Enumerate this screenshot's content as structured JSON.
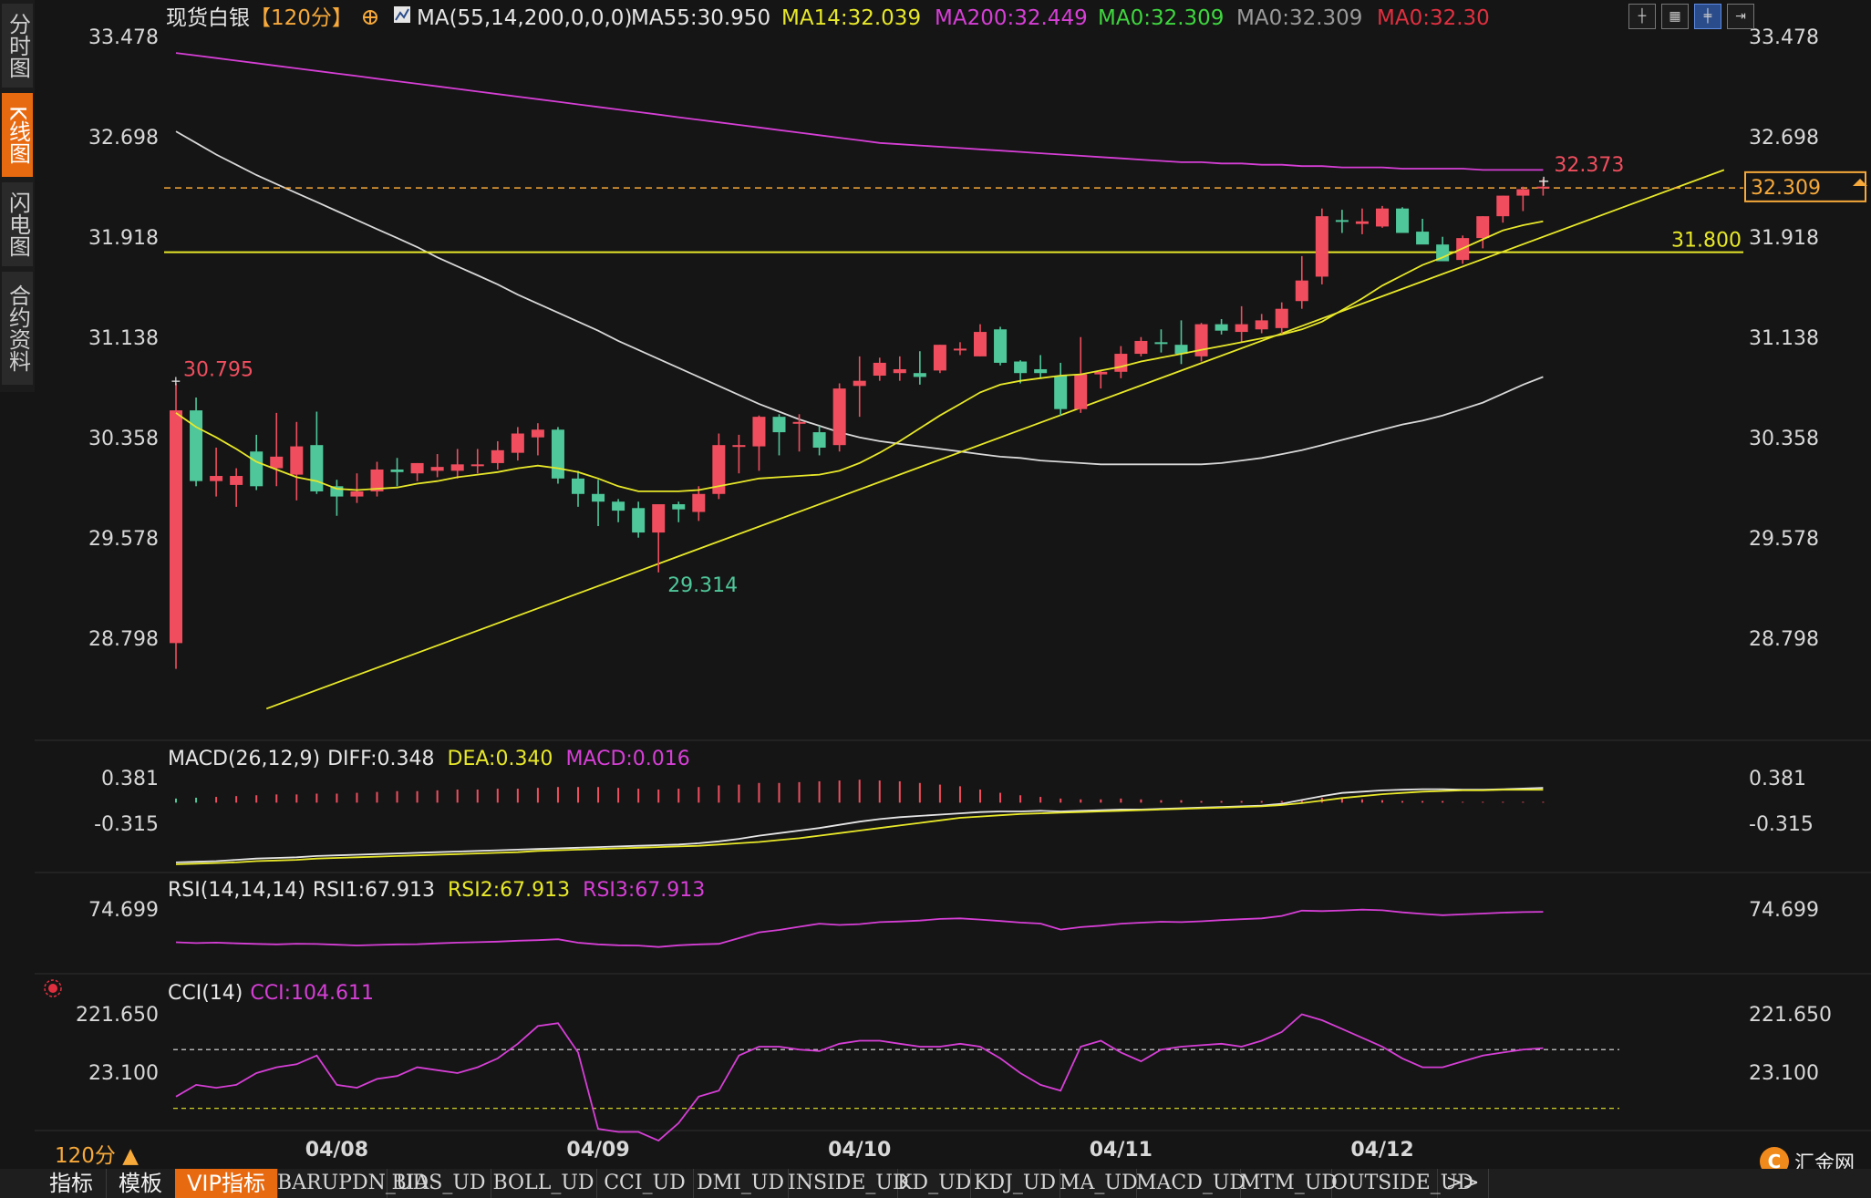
{
  "sidebar": {
    "tabs": [
      {
        "label": "分时图",
        "active": false
      },
      {
        "label": "K线图",
        "active": true
      },
      {
        "label": "闪电图",
        "active": false
      },
      {
        "label": "合约资料",
        "active": false
      }
    ]
  },
  "header": {
    "title": "现货白银",
    "period_tag": "【120分】",
    "indicator": "MA(55,14,200,0,0,0)",
    "ma55": "MA55:30.950",
    "ma14": "MA14:32.039",
    "ma200": "MA200:32.449",
    "ma0a": "MA0:32.309",
    "ma0b": "MA0:32.309",
    "ma0c": "MA0:32.30"
  },
  "colors": {
    "up": "#f04e5e",
    "down": "#4fc79a",
    "ma14": "#e8e82a",
    "ma55": "#d8d8d8",
    "ma200": "#d63fd6",
    "accent": "#f7a93a",
    "bg": "#151515",
    "grid": "#333333"
  },
  "toolbar": {
    "icons": [
      "crosshair-icon",
      "grid-icon",
      "candle-icon",
      "expand-icon"
    ]
  },
  "chart_data": [
    {
      "type": "candlestick",
      "panel": "price",
      "ylim": [
        28.2,
        33.5
      ],
      "yticks": [
        "33.478",
        "32.698",
        "31.918",
        "31.138",
        "30.358",
        "29.578",
        "28.798"
      ],
      "x_date_labels": [
        {
          "label": "04/08",
          "index": 8
        },
        {
          "label": "04/09",
          "index": 21
        },
        {
          "label": "04/10",
          "index": 34
        },
        {
          "label": "04/11",
          "index": 47
        },
        {
          "label": "04/12",
          "index": 60
        }
      ],
      "candles": [
        {
          "o": 28.76,
          "h": 30.78,
          "l": 28.56,
          "c": 30.57
        },
        {
          "o": 30.57,
          "h": 30.67,
          "l": 29.98,
          "c": 30.02
        },
        {
          "o": 30.02,
          "h": 30.28,
          "l": 29.9,
          "c": 30.06
        },
        {
          "o": 29.99,
          "h": 30.12,
          "l": 29.82,
          "c": 30.06
        },
        {
          "o": 30.25,
          "h": 30.38,
          "l": 29.95,
          "c": 29.98
        },
        {
          "o": 30.12,
          "h": 30.55,
          "l": 29.98,
          "c": 30.21
        },
        {
          "o": 30.07,
          "h": 30.48,
          "l": 29.87,
          "c": 30.29
        },
        {
          "o": 30.3,
          "h": 30.56,
          "l": 29.92,
          "c": 29.94
        },
        {
          "o": 29.98,
          "h": 30.03,
          "l": 29.75,
          "c": 29.9
        },
        {
          "o": 29.9,
          "h": 30.08,
          "l": 29.85,
          "c": 29.94
        },
        {
          "o": 29.94,
          "h": 30.17,
          "l": 29.9,
          "c": 30.11
        },
        {
          "o": 30.11,
          "h": 30.2,
          "l": 29.98,
          "c": 30.09
        },
        {
          "o": 30.08,
          "h": 30.16,
          "l": 30.02,
          "c": 30.16
        },
        {
          "o": 30.1,
          "h": 30.23,
          "l": 30.05,
          "c": 30.13
        },
        {
          "o": 30.1,
          "h": 30.27,
          "l": 30.04,
          "c": 30.15
        },
        {
          "o": 30.15,
          "h": 30.27,
          "l": 30.08,
          "c": 30.15
        },
        {
          "o": 30.16,
          "h": 30.33,
          "l": 30.11,
          "c": 30.26
        },
        {
          "o": 30.24,
          "h": 30.44,
          "l": 30.18,
          "c": 30.39
        },
        {
          "o": 30.36,
          "h": 30.47,
          "l": 30.22,
          "c": 30.42
        },
        {
          "o": 30.42,
          "h": 30.44,
          "l": 30.0,
          "c": 30.04
        },
        {
          "o": 30.04,
          "h": 30.1,
          "l": 29.82,
          "c": 29.92
        },
        {
          "o": 29.92,
          "h": 30.03,
          "l": 29.67,
          "c": 29.86
        },
        {
          "o": 29.86,
          "h": 29.88,
          "l": 29.7,
          "c": 29.79
        },
        {
          "o": 29.81,
          "h": 29.86,
          "l": 29.58,
          "c": 29.62
        },
        {
          "o": 29.62,
          "h": 29.82,
          "l": 29.31,
          "c": 29.84
        },
        {
          "o": 29.84,
          "h": 29.86,
          "l": 29.7,
          "c": 29.8
        },
        {
          "o": 29.78,
          "h": 29.98,
          "l": 29.71,
          "c": 29.92
        },
        {
          "o": 29.92,
          "h": 30.39,
          "l": 29.88,
          "c": 30.3
        },
        {
          "o": 30.3,
          "h": 30.38,
          "l": 30.08,
          "c": 30.3
        },
        {
          "o": 30.29,
          "h": 30.53,
          "l": 30.1,
          "c": 30.52
        },
        {
          "o": 30.52,
          "h": 30.54,
          "l": 30.22,
          "c": 30.4
        },
        {
          "o": 30.48,
          "h": 30.54,
          "l": 30.25,
          "c": 30.48
        },
        {
          "o": 30.4,
          "h": 30.45,
          "l": 30.22,
          "c": 30.28
        },
        {
          "o": 30.3,
          "h": 30.78,
          "l": 30.25,
          "c": 30.74
        },
        {
          "o": 30.76,
          "h": 30.99,
          "l": 30.52,
          "c": 30.8
        },
        {
          "o": 30.84,
          "h": 30.98,
          "l": 30.8,
          "c": 30.94
        },
        {
          "o": 30.86,
          "h": 30.99,
          "l": 30.8,
          "c": 30.89
        },
        {
          "o": 30.86,
          "h": 31.03,
          "l": 30.77,
          "c": 30.83
        },
        {
          "o": 30.88,
          "h": 31.08,
          "l": 30.86,
          "c": 31.08
        },
        {
          "o": 31.05,
          "h": 31.1,
          "l": 31.0,
          "c": 31.05
        },
        {
          "o": 30.99,
          "h": 31.24,
          "l": 30.99,
          "c": 31.18
        },
        {
          "o": 31.2,
          "h": 31.22,
          "l": 30.92,
          "c": 30.94
        },
        {
          "o": 30.95,
          "h": 30.96,
          "l": 30.78,
          "c": 30.86
        },
        {
          "o": 30.89,
          "h": 31.0,
          "l": 30.82,
          "c": 30.86
        },
        {
          "o": 30.84,
          "h": 30.94,
          "l": 30.53,
          "c": 30.58
        },
        {
          "o": 30.58,
          "h": 31.14,
          "l": 30.55,
          "c": 30.85
        },
        {
          "o": 30.85,
          "h": 30.88,
          "l": 30.74,
          "c": 30.87
        },
        {
          "o": 30.87,
          "h": 31.07,
          "l": 30.82,
          "c": 31.01
        },
        {
          "o": 31.01,
          "h": 31.14,
          "l": 30.99,
          "c": 31.11
        },
        {
          "o": 31.1,
          "h": 31.2,
          "l": 31.02,
          "c": 31.09
        },
        {
          "o": 31.08,
          "h": 31.27,
          "l": 30.93,
          "c": 31.01
        },
        {
          "o": 30.99,
          "h": 31.25,
          "l": 30.95,
          "c": 31.24
        },
        {
          "o": 31.24,
          "h": 31.28,
          "l": 31.16,
          "c": 31.19
        },
        {
          "o": 31.18,
          "h": 31.38,
          "l": 31.1,
          "c": 31.24
        },
        {
          "o": 31.2,
          "h": 31.32,
          "l": 31.17,
          "c": 31.27
        },
        {
          "o": 31.21,
          "h": 31.41,
          "l": 31.16,
          "c": 31.36
        },
        {
          "o": 31.42,
          "h": 31.77,
          "l": 31.36,
          "c": 31.58
        },
        {
          "o": 31.61,
          "h": 32.14,
          "l": 31.55,
          "c": 32.08
        },
        {
          "o": 32.05,
          "h": 32.13,
          "l": 31.95,
          "c": 32.04
        },
        {
          "o": 32.02,
          "h": 32.14,
          "l": 31.94,
          "c": 32.04
        },
        {
          "o": 32.0,
          "h": 32.16,
          "l": 31.99,
          "c": 32.14
        },
        {
          "o": 32.14,
          "h": 32.15,
          "l": 31.98,
          "c": 31.95
        },
        {
          "o": 31.96,
          "h": 32.06,
          "l": 31.9,
          "c": 31.86
        },
        {
          "o": 31.86,
          "h": 31.92,
          "l": 31.76,
          "c": 31.73
        },
        {
          "o": 31.74,
          "h": 31.93,
          "l": 31.71,
          "c": 31.91
        },
        {
          "o": 31.91,
          "h": 32.08,
          "l": 31.83,
          "c": 32.08
        },
        {
          "o": 32.08,
          "h": 32.24,
          "l": 32.03,
          "c": 32.24
        },
        {
          "o": 32.24,
          "h": 32.31,
          "l": 32.12,
          "c": 32.29
        },
        {
          "o": 32.3,
          "h": 32.37,
          "l": 32.24,
          "c": 32.31
        }
      ],
      "ma14": [
        30.55,
        30.44,
        30.36,
        30.27,
        30.17,
        30.11,
        30.05,
        30.02,
        29.96,
        29.95,
        29.96,
        29.97,
        30.0,
        30.02,
        30.05,
        30.07,
        30.09,
        30.12,
        30.14,
        30.12,
        30.09,
        30.04,
        29.98,
        29.94,
        29.94,
        29.94,
        29.95,
        29.98,
        30.01,
        30.04,
        30.05,
        30.06,
        30.07,
        30.1,
        30.16,
        30.24,
        30.33,
        30.43,
        30.53,
        30.62,
        30.71,
        30.77,
        30.8,
        30.82,
        30.84,
        30.85,
        30.88,
        30.91,
        30.95,
        30.98,
        31.01,
        31.04,
        31.07,
        31.1,
        31.13,
        31.16,
        31.2,
        31.26,
        31.35,
        31.44,
        31.54,
        31.62,
        31.7,
        31.76,
        31.83,
        31.9,
        31.97,
        32.01,
        32.04
      ],
      "ma55": [
        32.74,
        32.65,
        32.56,
        32.48,
        32.4,
        32.33,
        32.26,
        32.19,
        32.12,
        32.05,
        31.98,
        31.91,
        31.84,
        31.76,
        31.69,
        31.62,
        31.55,
        31.47,
        31.4,
        31.33,
        31.26,
        31.19,
        31.11,
        31.04,
        30.97,
        30.9,
        30.83,
        30.76,
        30.69,
        30.62,
        30.56,
        30.5,
        30.45,
        30.4,
        30.36,
        30.33,
        30.31,
        30.29,
        30.27,
        30.25,
        30.23,
        30.21,
        30.2,
        30.18,
        30.17,
        30.16,
        30.15,
        30.15,
        30.15,
        30.15,
        30.15,
        30.15,
        30.16,
        30.18,
        30.2,
        30.23,
        30.26,
        30.3,
        30.34,
        30.38,
        30.42,
        30.46,
        30.49,
        30.53,
        30.58,
        30.63,
        30.7,
        30.77,
        30.83
      ],
      "ma200": [
        33.35,
        33.33,
        33.31,
        33.29,
        33.27,
        33.25,
        33.23,
        33.21,
        33.19,
        33.17,
        33.15,
        33.13,
        33.11,
        33.09,
        33.07,
        33.05,
        33.03,
        33.01,
        32.99,
        32.97,
        32.95,
        32.93,
        32.91,
        32.89,
        32.87,
        32.85,
        32.83,
        32.81,
        32.79,
        32.77,
        32.75,
        32.73,
        32.71,
        32.69,
        32.67,
        32.65,
        32.64,
        32.63,
        32.62,
        32.61,
        32.6,
        32.59,
        32.58,
        32.57,
        32.56,
        32.55,
        32.54,
        32.53,
        32.52,
        32.51,
        32.5,
        32.5,
        32.49,
        32.49,
        32.48,
        32.48,
        32.47,
        32.47,
        32.46,
        32.46,
        32.46,
        32.45,
        32.45,
        32.45,
        32.45,
        32.44,
        32.44,
        32.44,
        32.44
      ],
      "trendline": [
        {
          "i": 4.5,
          "v": 28.25
        },
        {
          "i": 77,
          "v": 32.44
        }
      ],
      "hlines": [
        {
          "v": 31.8,
          "label": "31.800",
          "style": "solid"
        },
        {
          "v": 32.3,
          "label": "",
          "style": "dash"
        }
      ],
      "annotations": [
        {
          "label": "30.795",
          "i": 0,
          "v": 30.795
        },
        {
          "label": "29.314",
          "i": 24,
          "v": 29.314
        },
        {
          "label": "32.373",
          "i": 68,
          "v": 32.373
        }
      ],
      "last_price": "32.309"
    },
    {
      "type": "macd",
      "panel": "macd",
      "label": "MACD(26,12,9)",
      "diff_label": "DIFF:0.348",
      "dea_label": "DEA:0.340",
      "macd_label": "MACD:0.016",
      "yticks": [
        "0.381",
        "-0.315"
      ],
      "ylim": [
        -0.95,
        0.5
      ],
      "diff": [
        -0.92,
        -0.91,
        -0.9,
        -0.88,
        -0.86,
        -0.85,
        -0.84,
        -0.82,
        -0.81,
        -0.8,
        -0.79,
        -0.78,
        -0.77,
        -0.76,
        -0.75,
        -0.74,
        -0.73,
        -0.72,
        -0.71,
        -0.7,
        -0.69,
        -0.68,
        -0.67,
        -0.66,
        -0.65,
        -0.64,
        -0.62,
        -0.59,
        -0.55,
        -0.5,
        -0.46,
        -0.42,
        -0.38,
        -0.33,
        -0.28,
        -0.24,
        -0.21,
        -0.19,
        -0.17,
        -0.15,
        -0.13,
        -0.12,
        -0.12,
        -0.11,
        -0.12,
        -0.11,
        -0.1,
        -0.09,
        -0.09,
        -0.08,
        -0.07,
        -0.06,
        -0.05,
        -0.04,
        -0.03,
        0.0,
        0.06,
        0.12,
        0.17,
        0.19,
        0.21,
        0.22,
        0.23,
        0.23,
        0.22,
        0.22,
        0.23,
        0.24,
        0.25
      ],
      "dea": [
        -0.95,
        -0.94,
        -0.93,
        -0.92,
        -0.9,
        -0.89,
        -0.88,
        -0.86,
        -0.85,
        -0.84,
        -0.83,
        -0.82,
        -0.81,
        -0.8,
        -0.79,
        -0.78,
        -0.77,
        -0.76,
        -0.74,
        -0.73,
        -0.72,
        -0.71,
        -0.7,
        -0.69,
        -0.68,
        -0.67,
        -0.66,
        -0.64,
        -0.62,
        -0.6,
        -0.57,
        -0.54,
        -0.5,
        -0.46,
        -0.42,
        -0.38,
        -0.34,
        -0.3,
        -0.26,
        -0.22,
        -0.2,
        -0.18,
        -0.16,
        -0.15,
        -0.14,
        -0.13,
        -0.12,
        -0.11,
        -0.1,
        -0.09,
        -0.08,
        -0.07,
        -0.06,
        -0.05,
        -0.04,
        -0.02,
        0.01,
        0.05,
        0.09,
        0.12,
        0.15,
        0.17,
        0.19,
        0.2,
        0.21,
        0.21,
        0.22,
        0.22,
        0.22
      ],
      "hist": [
        0.05,
        0.06,
        0.07,
        0.08,
        0.09,
        0.1,
        0.1,
        0.11,
        0.11,
        0.12,
        0.13,
        0.14,
        0.14,
        0.15,
        0.16,
        0.16,
        0.17,
        0.17,
        0.18,
        0.19,
        0.19,
        0.19,
        0.18,
        0.17,
        0.16,
        0.17,
        0.19,
        0.21,
        0.22,
        0.24,
        0.24,
        0.25,
        0.26,
        0.27,
        0.28,
        0.27,
        0.26,
        0.24,
        0.22,
        0.2,
        0.16,
        0.12,
        0.09,
        0.07,
        0.05,
        0.04,
        0.04,
        0.05,
        0.04,
        0.03,
        0.03,
        0.02,
        0.02,
        0.02,
        0.02,
        0.02,
        0.04,
        0.06,
        0.05,
        0.04,
        0.03,
        0.02,
        0.02,
        0.02,
        0.01,
        0.01,
        0.01,
        0.01,
        0.01
      ]
    },
    {
      "type": "line",
      "panel": "rsi",
      "label": "RSI(14,14,14)",
      "rsi1_label": "RSI1:67.913",
      "rsi2_label": "RSI2:67.913",
      "rsi3_label": "RSI3:67.913",
      "yticks": [
        "74.699"
      ],
      "ylim": [
        20,
        85
      ],
      "values": [
        44.5,
        43.8,
        44.2,
        43.5,
        43.0,
        42.6,
        43.2,
        42.9,
        42.3,
        41.6,
        42.1,
        42.6,
        42.8,
        43.5,
        44.2,
        44.6,
        45.1,
        45.9,
        46.4,
        47.2,
        44.1,
        42.6,
        41.8,
        41.5,
        40.2,
        41.8,
        42.6,
        43.1,
        48.2,
        53.5,
        55.7,
        58.6,
        61.4,
        60.2,
        61.0,
        62.8,
        63.4,
        64.2,
        65.7,
        66.2,
        65.1,
        63.8,
        62.4,
        61.5,
        56.0,
        58.2,
        59.6,
        61.4,
        62.3,
        63.1,
        62.8,
        63.5,
        64.6,
        65.4,
        66.2,
        68.4,
        73.2,
        72.8,
        73.4,
        74.1,
        73.5,
        71.6,
        70.2,
        69.1,
        69.8,
        70.6,
        71.4,
        71.9,
        72.1
      ]
    },
    {
      "type": "line",
      "panel": "cci",
      "label": "CCI(14)",
      "cci_label": "CCI:104.611",
      "yticks": [
        "221.650",
        "23.100"
      ],
      "ylim": [
        -220,
        320
      ],
      "values": [
        -60,
        -20,
        -30,
        -20,
        20,
        40,
        50,
        80,
        -20,
        -30,
        0,
        10,
        40,
        30,
        20,
        40,
        70,
        120,
        180,
        190,
        90,
        -170,
        -180,
        -180,
        -210,
        -150,
        -60,
        -40,
        80,
        110,
        110,
        100,
        95,
        120,
        130,
        130,
        120,
        110,
        110,
        120,
        110,
        70,
        20,
        -20,
        -40,
        110,
        130,
        90,
        60,
        100,
        110,
        115,
        120,
        110,
        130,
        160,
        220,
        200,
        170,
        140,
        110,
        70,
        40,
        40,
        60,
        80,
        90,
        100,
        105
      ]
    }
  ],
  "indicator_legend": {
    "cci_marker": "cci-gear-icon"
  },
  "period_label": "120分 ▲",
  "logo_text": "汇金网",
  "bottom_tabs": [
    "指标",
    "模板",
    "VIP指标",
    "BARUPDN_UD",
    "BIAS_UD",
    "BOLL_UD",
    "CCI_UD",
    "DMI_UD",
    "INSIDE_UD",
    "KD_UD",
    "KDJ_UD",
    "MA_UD",
    "MACD_UD",
    "MTM_UD",
    "OUTSIDE_UD",
    ">>"
  ]
}
